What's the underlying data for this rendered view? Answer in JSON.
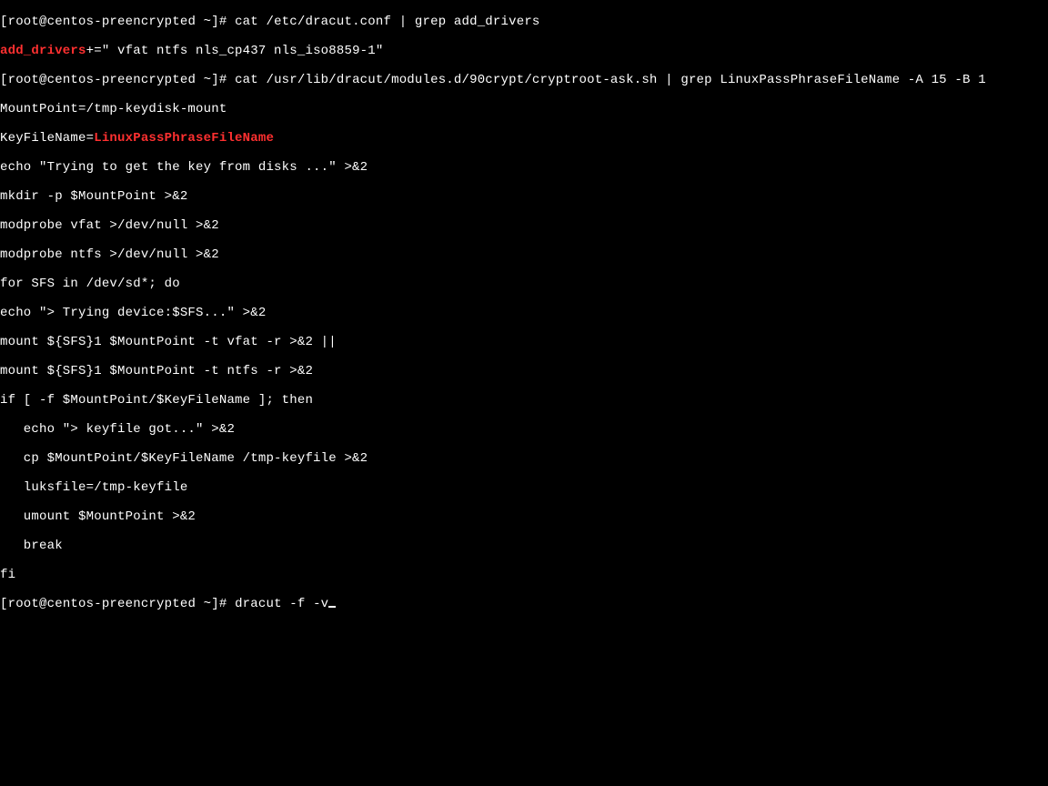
{
  "prompt": {
    "open": "[",
    "user": "root@centos-preencrypted",
    "cwd": " ~]# ",
    "close": ""
  },
  "cmd1": "cat /etc/dracut.conf | grep add_drivers",
  "out1": {
    "hl": "add_drivers",
    "rest": "+=\" vfat ntfs nls_cp437 nls_iso8859-1\""
  },
  "cmd2": "cat /usr/lib/dracut/modules.d/90crypt/cryptroot-ask.sh | grep LinuxPassPhraseFileName -A 15 -B 1",
  "out2": [
    "MountPoint=/tmp-keydisk-mount"
  ],
  "out2_keyfile": {
    "pre": "KeyFileName=",
    "hl": "LinuxPassPhraseFileName"
  },
  "out2b": [
    "echo \"Trying to get the key from disks ...\" >&2",
    "mkdir -p $MountPoint >&2",
    "modprobe vfat >/dev/null >&2",
    "modprobe ntfs >/dev/null >&2",
    "for SFS in /dev/sd*; do",
    "echo \"> Trying device:$SFS...\" >&2",
    "mount ${SFS}1 $MountPoint -t vfat -r >&2 ||",
    "mount ${SFS}1 $MountPoint -t ntfs -r >&2",
    "if [ -f $MountPoint/$KeyFileName ]; then",
    "   echo \"> keyfile got...\" >&2",
    "   cp $MountPoint/$KeyFileName /tmp-keyfile >&2",
    "   luksfile=/tmp-keyfile",
    "   umount $MountPoint >&2",
    "   break",
    "fi"
  ],
  "cmd3": "dracut -f -v"
}
